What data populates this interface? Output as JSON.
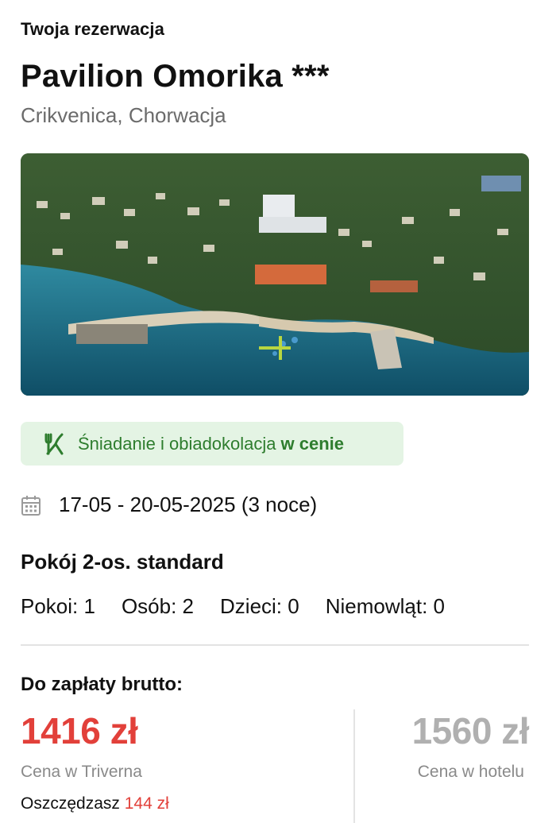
{
  "reservation": {
    "section_title": "Twoja rezerwacja",
    "hotel_name": "Pavilion Omorika ***",
    "location": "Crikvenica, Chorwacja",
    "photo_icon": "hotel-aerial-photo"
  },
  "board": {
    "icon": "fork-knife-icon",
    "label": "Śniadanie i obiadokolacja",
    "included": "w cenie",
    "colors": {
      "background": "#e4f4e4",
      "text": "#2e7d2e"
    }
  },
  "stay": {
    "icon": "calendar-icon",
    "dates": "17-05 - 20-05-2025 (3 noce)"
  },
  "room": {
    "type": "Pokój 2-os. standard",
    "occupancy": [
      {
        "label": "Pokoi: 1"
      },
      {
        "label": "Osób: 2"
      },
      {
        "label": "Dzieci: 0"
      },
      {
        "label": "Niemowląt: 0"
      }
    ]
  },
  "payment": {
    "title": "Do zapłaty brutto:",
    "our_price": "1416 zł",
    "our_price_label": "Cena w Triverna",
    "savings_prefix": "Oszczędzasz",
    "savings_amount": "144 zł",
    "hotel_price": "1560 zł",
    "hotel_price_label": "Cena w hotelu",
    "colors": {
      "accent": "#e2403a",
      "muted_price": "#b0b0b0"
    }
  }
}
